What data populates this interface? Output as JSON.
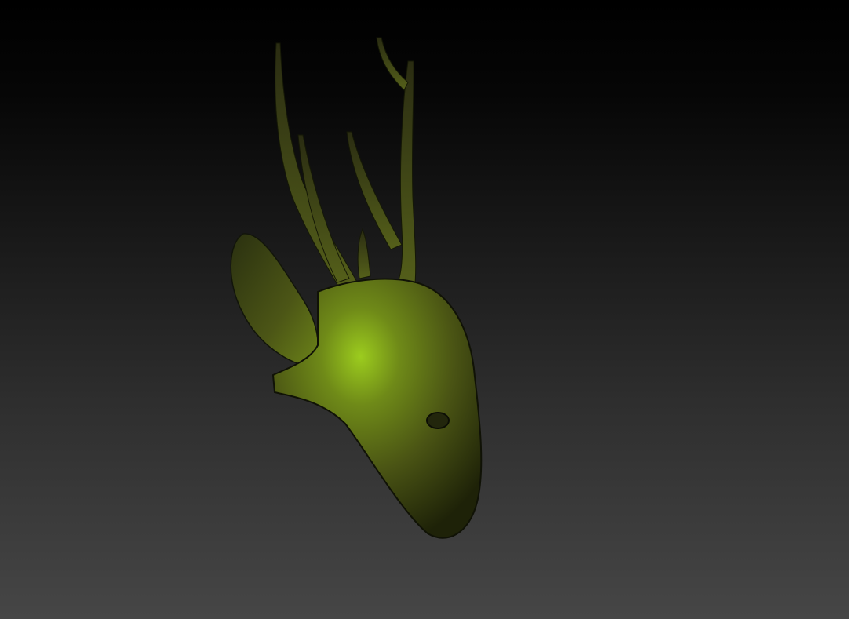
{
  "viewport": {
    "background_top": "#000000",
    "background_bottom": "#464646"
  },
  "model": {
    "subject": "deer-head",
    "base_color": "#4f5a14",
    "highlight_color": "#9ccc1e",
    "shadow_color": "#1e2208"
  }
}
